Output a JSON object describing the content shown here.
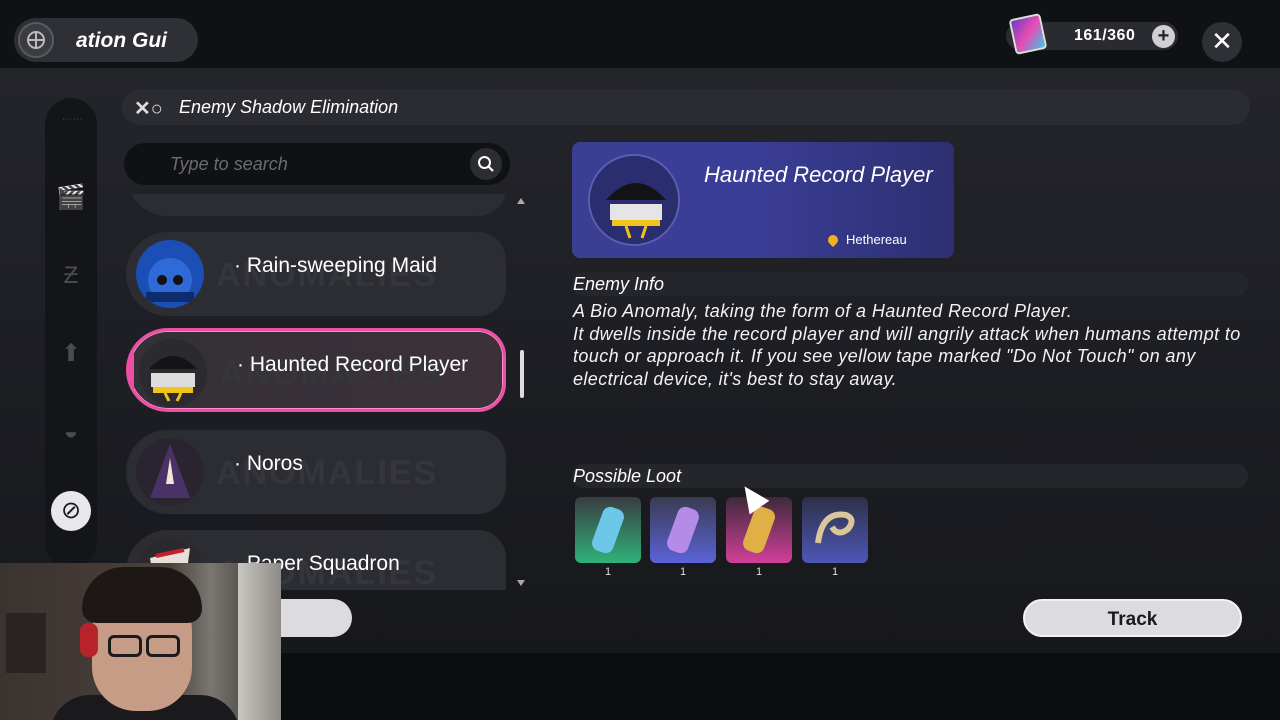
{
  "topbar": {
    "title": "Proliferation Guide",
    "title_visible": "ation Gui",
    "currency_value": "161/360",
    "plus_label": "+",
    "close_label": "✕"
  },
  "header": {
    "title": "Enemy Shadow Elimination"
  },
  "search": {
    "placeholder": "Type to search"
  },
  "enemies": [
    {
      "name": "· Rain-sweeping Maid",
      "ghost": "ANOMALIES"
    },
    {
      "name": "· Haunted Record Player",
      "ghost": "ANOMALIES",
      "selected": true
    },
    {
      "name": "· Noros",
      "ghost": "ANOMALIES"
    },
    {
      "name": "· Paper Squadron",
      "ghost": "ANOMALIES"
    }
  ],
  "detail": {
    "name": "Haunted Record Player",
    "location": "Hethereau",
    "info_title": "Enemy Info",
    "description": "A Bio Anomaly, taking the form of a Haunted Record Player.\nIt dwells inside the record player and will angrily attack when humans attempt to touch or approach it. If you see yellow tape marked \"Do Not Touch\" on any electrical device, it's best to stay away.",
    "loot_title": "Possible Loot",
    "loot": [
      {
        "count": "1",
        "rarity_color": "#2fb37a"
      },
      {
        "count": "1",
        "rarity_color": "#5a63d8"
      },
      {
        "count": "1",
        "rarity_color": "#d23f9a"
      },
      {
        "count": "1",
        "rarity_color": "#4c57b8"
      }
    ]
  },
  "actions": {
    "track_label": "Track"
  },
  "colors": {
    "accent": "#ec4fa3",
    "card": "#3a3f93",
    "location_pin": "#f3b021"
  }
}
